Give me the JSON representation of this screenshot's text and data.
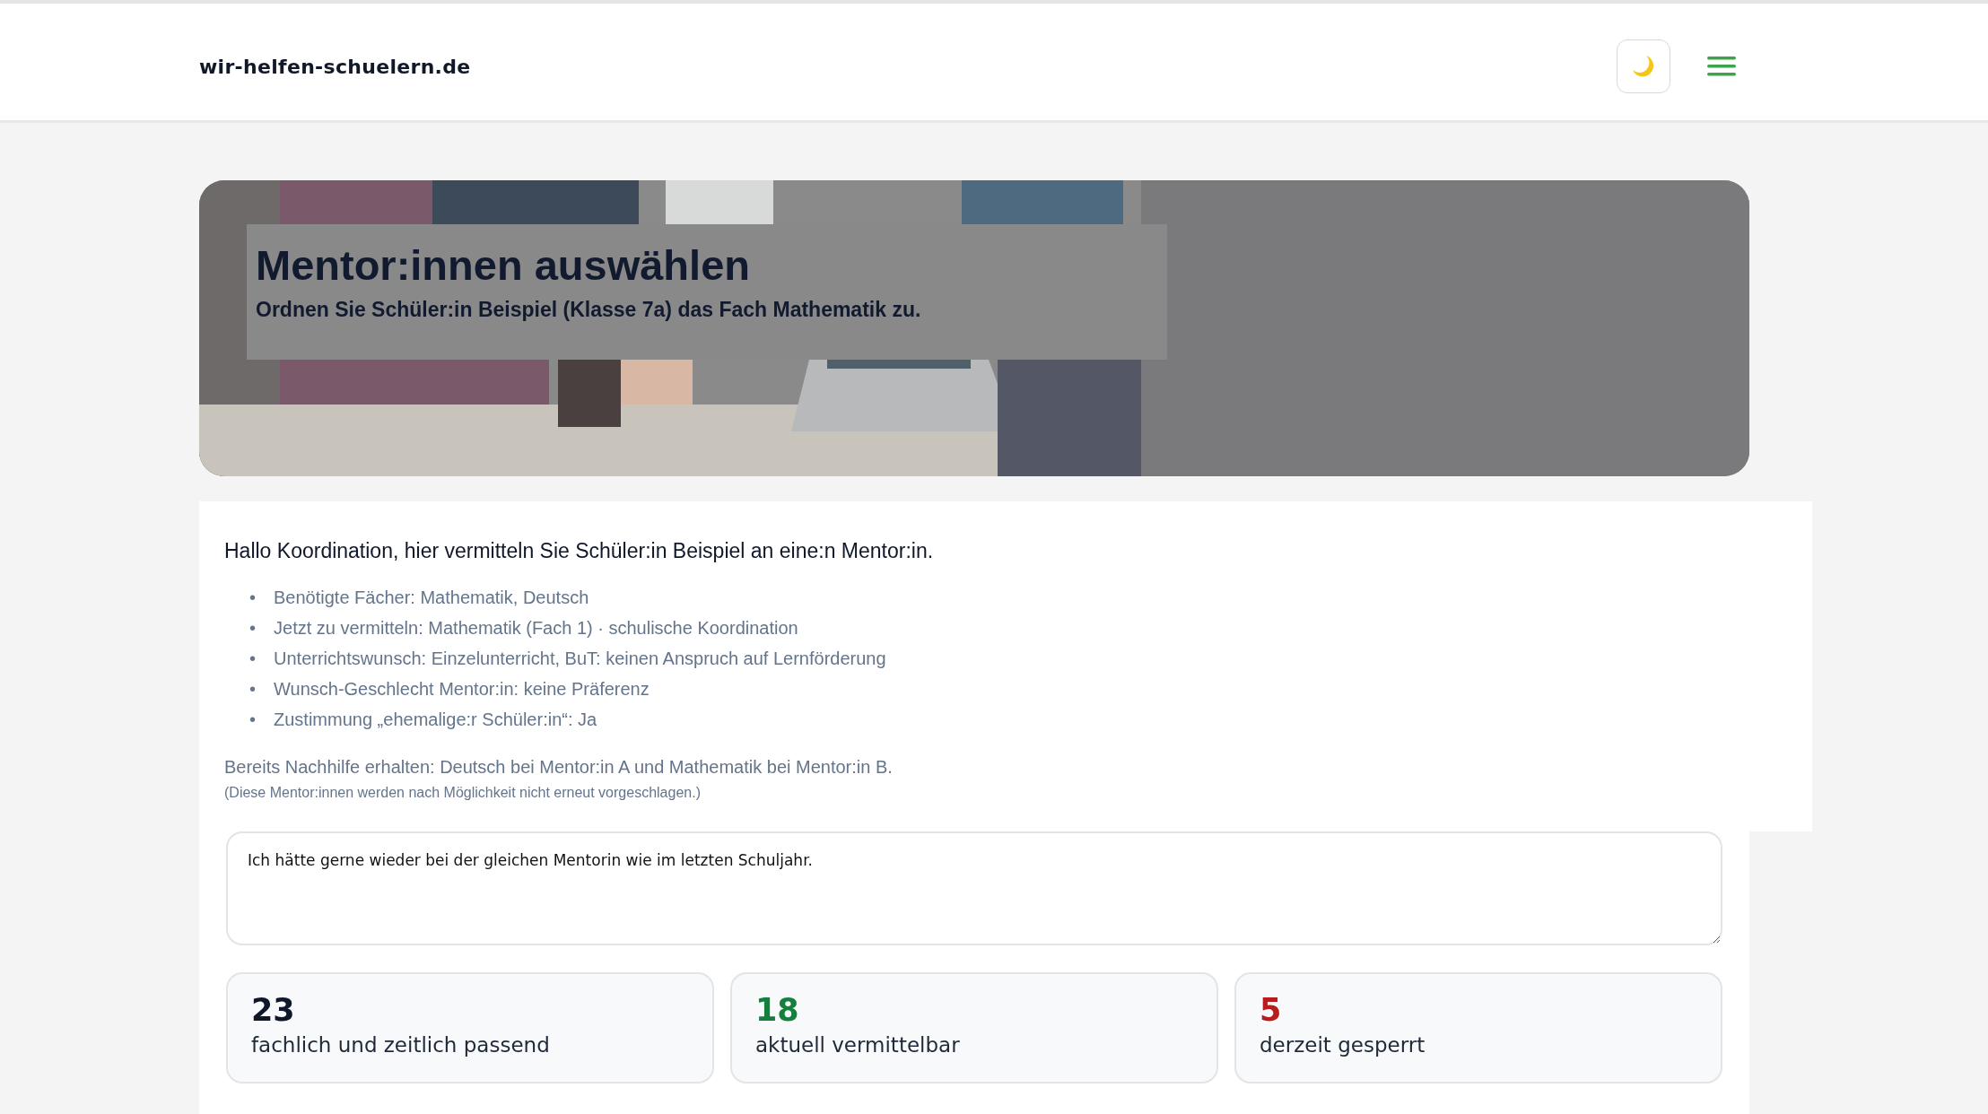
{
  "header": {
    "brand": "wir-helfen-schuelern.de"
  },
  "hero": {
    "kind": "picture",
    "title": "Mentor:innen auswählen",
    "subtitle": "Ordnen Sie Schüler:in Beispiel (Klasse 7a) das Fach Mathematik zu."
  },
  "info": {
    "greeting": "Hallo Koordination, hier vermitteln Sie Schüler:in Beispiel an eine:n Mentor:in.",
    "details": [
      {
        "bullet": "•",
        "text": "Benötigte Fächer: Mathematik, Deutsch"
      },
      {
        "bullet": "•",
        "text": "Jetzt zu vermitteln: Mathematik (Fach 1) · schulische Koordination"
      },
      {
        "bullet": "•",
        "text": "Unterrichtswunsch: Einzelunterricht, BuT: keinen Anspruch auf Lernförderung"
      },
      {
        "bullet": "•",
        "text": "Wunsch-Geschlecht Mentor:in: keine Präferenz"
      },
      {
        "bullet": "•",
        "text": "Zustimmung „ehemalige:r Schüler:in“: Ja"
      }
    ],
    "previous": "Bereits Nachhilfe erhalten: Deutsch bei Mentor:in A und Mathematik bei Mentor:in B.",
    "previous_hint": "(Diese Mentor:innen werden nach Möglichkeit nicht erneut vorgeschlagen.)"
  },
  "wish": {
    "value": "Ich hätte gerne wieder bei der gleichen Mentorin wie im letzten Schuljahr."
  },
  "stats": [
    {
      "kind": "neutral",
      "value": "23",
      "label": "fachlich und zeitlich passend"
    },
    {
      "kind": "positive",
      "value": "18",
      "label": "aktuell vermittelbar"
    },
    {
      "kind": "negative",
      "value": "5",
      "label": "derzeit gesperrt"
    }
  ]
}
